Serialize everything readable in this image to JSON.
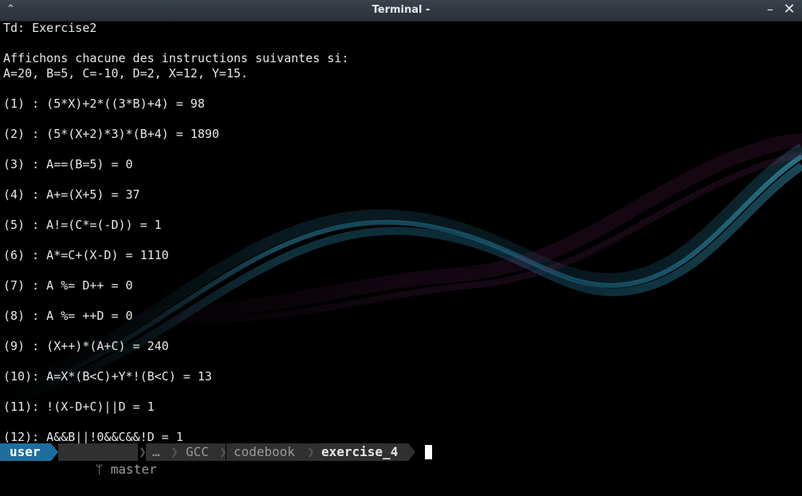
{
  "window": {
    "title": "Terminal -",
    "menu_icon": "chevron-up-icon",
    "minimize_glyph": "–",
    "close_glyph": "✕"
  },
  "terminal": {
    "lines": [
      "Td: Exercise2",
      "",
      "Affichons chacune des instructions suivantes si:",
      "A=20, B=5, C=-10, D=2, X=12, Y=15.",
      "",
      "(1) : (5*X)+2*((3*B)+4) = 98",
      "",
      "(2) : (5*(X+2)*3)*(B+4) = 1890",
      "",
      "(3) : A==(B=5) = 0",
      "",
      "(4) : A+=(X+5) = 37",
      "",
      "(5) : A!=(C*=(-D)) = 1",
      "",
      "(6) : A*=C+(X-D) = 1110",
      "",
      "(7) : A %= D++ = 0",
      "",
      "(8) : A %= ++D = 0",
      "",
      "(9) : (X++)*(A+C) = 240",
      "",
      "(10): A=X*(B<C)+Y*!(B<C) = 13",
      "",
      "(11): !(X-D+C)||D = 1",
      "",
      "(12): A&&B||!0&&C&&!D = 1"
    ],
    "text_color": "#e8e8e8",
    "background_color": "#000000"
  },
  "prompt": {
    "user": "user",
    "branch_icon": "git-branch-icon",
    "branch_glyph": "ᛘ",
    "branch": "master",
    "path": [
      "…",
      "GCC",
      "codebook"
    ],
    "current_dir": "exercise_4",
    "user_color": "#1e6f9f",
    "segment_color": "#303030"
  }
}
